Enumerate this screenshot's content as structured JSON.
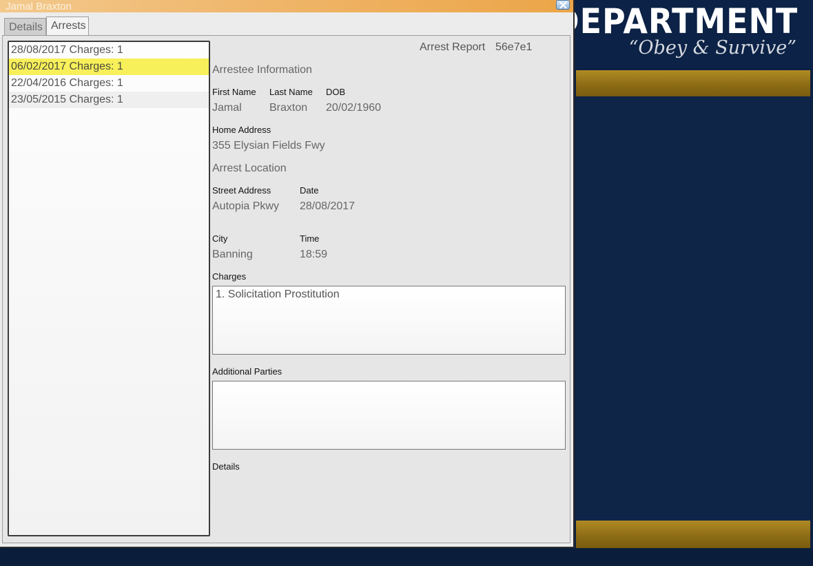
{
  "background": {
    "department_text": "E DEPARTMENT",
    "motto": "“Obey & Survive”"
  },
  "window": {
    "title": "Jamal Braxton",
    "close_icon": "close-icon"
  },
  "tabs": [
    {
      "label": "Details"
    },
    {
      "label": "Arrests"
    }
  ],
  "arrests": [
    {
      "label": "28/08/2017 Charges: 1"
    },
    {
      "label": "06/02/2017 Charges: 1"
    },
    {
      "label": "22/04/2016 Charges: 1"
    },
    {
      "label": "23/05/2015 Charges: 1"
    }
  ],
  "report": {
    "label": "Arrest Report",
    "id": "56e7e1",
    "arrestee_header": "Arrestee Information",
    "first_name_label": "First Name",
    "first_name": "Jamal",
    "last_name_label": "Last Name",
    "last_name": "Braxton",
    "dob_label": "DOB",
    "dob": "20/02/1960",
    "home_address_label": "Home Address",
    "home_address": "355 Elysian Fields Fwy",
    "location_header": "Arrest Location",
    "street_label": "Street Address",
    "street": "Autopia Pkwy",
    "date_label": "Date",
    "date": "28/08/2017",
    "city_label": "City",
    "city": "Banning",
    "time_label": "Time",
    "time": "18:59",
    "charges_label": "Charges",
    "charges_text": "1. Solicitation Prostitution",
    "additional_parties_label": "Additional Parties",
    "additional_parties_text": "",
    "details_label": "Details"
  },
  "colors": {
    "titlebar": "#eca548",
    "selected_row": "#f7f05a",
    "background_navy": "#0d2142",
    "gold_band": "#8a6a14"
  }
}
